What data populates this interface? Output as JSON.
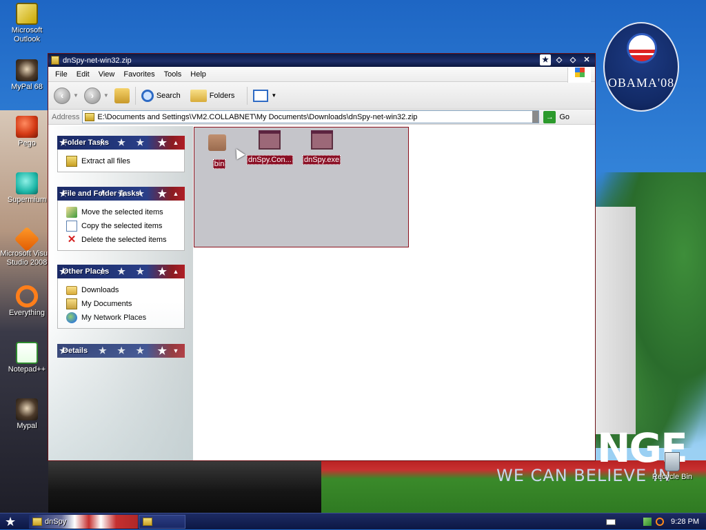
{
  "desktop": {
    "icons": [
      {
        "label": "Microsoft Outlook",
        "icon": "outlook-icon"
      },
      {
        "label": "MyPal 68",
        "icon": "mypal-icon"
      },
      {
        "label": "Pego",
        "icon": "pego-icon"
      },
      {
        "label": "Supermium",
        "icon": "supermium-icon"
      },
      {
        "label": "Microsoft Visual Studio 2008",
        "icon": "visual-studio-icon"
      },
      {
        "label": "Everything",
        "icon": "everything-icon"
      },
      {
        "label": "Notepad++",
        "icon": "notepad-plus-plus-icon"
      },
      {
        "label": "Mypal",
        "icon": "mypal-icon"
      }
    ],
    "recycle_bin": "Recycle Bin",
    "wallpaper": {
      "logo_text": "OBAMA'08",
      "slogan_big": "NGE",
      "slogan_small": "WE CAN BELIEVE IN"
    }
  },
  "window": {
    "title": "dnSpy-net-win32.zip",
    "menu": [
      "File",
      "Edit",
      "View",
      "Favorites",
      "Tools",
      "Help"
    ],
    "toolbar": {
      "back": "Back",
      "search": "Search",
      "folders": "Folders"
    },
    "address": {
      "label": "Address",
      "value": "E:\\Documents and Settings\\VM2.COLLABNET\\My Documents\\Downloads\\dnSpy-net-win32.zip",
      "go": "Go"
    },
    "tasks": {
      "folder_tasks": {
        "title": "Folder Tasks",
        "items": [
          "Extract all files"
        ]
      },
      "file_folder_tasks": {
        "title": "File and Folder Tasks",
        "items": [
          "Move the selected items",
          "Copy the selected items",
          "Delete the selected items"
        ]
      },
      "other_places": {
        "title": "Other Places",
        "items": [
          "Downloads",
          "My Documents",
          "My Network Places"
        ]
      },
      "details": {
        "title": "Details"
      }
    },
    "files": [
      {
        "name": "bin",
        "type": "folder"
      },
      {
        "name": "dnSpy.Con...",
        "type": "exe"
      },
      {
        "name": "dnSpy.exe",
        "type": "exe"
      }
    ]
  },
  "taskbar": {
    "buttons": [
      "dnSpy",
      ""
    ],
    "clock": "9:28 PM"
  },
  "colors": {
    "titlebar": "#0b1740",
    "selection_label": "#8a0f24",
    "task_header_blue": "#1b2a66",
    "task_header_red": "#b01f26"
  }
}
